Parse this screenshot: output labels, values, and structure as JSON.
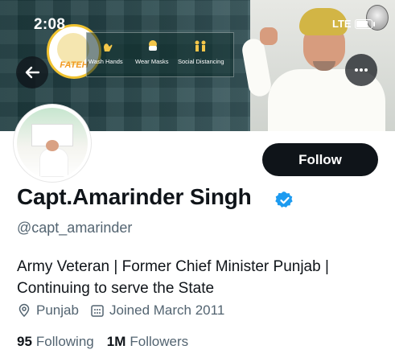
{
  "status_bar": {
    "time": "2:08",
    "network": "LTE"
  },
  "banner": {
    "logo_text": "FATEH",
    "campaign_items": [
      "Wash Hands",
      "Wear Masks",
      "Social Distancing"
    ]
  },
  "nav": {
    "back_icon": "arrow-left-icon",
    "more_icon": "more-horizontal-icon"
  },
  "profile": {
    "name": "Capt.Amarinder Singh",
    "verified": true,
    "handle": "@capt_amarinder",
    "follow_label": "Follow",
    "bio_lines": [
      "Army Veteran | Former Chief Minister Punjab |",
      "Continuing to serve the State"
    ],
    "location": "Punjab",
    "joined": "Joined March 2011",
    "following_count": "95",
    "following_label": "Following",
    "followers_count": "1M",
    "followers_label": "Followers"
  },
  "colors": {
    "accent_verified": "#1d9bf0",
    "follow_button_bg": "#0f1419",
    "text_secondary": "#536471"
  }
}
